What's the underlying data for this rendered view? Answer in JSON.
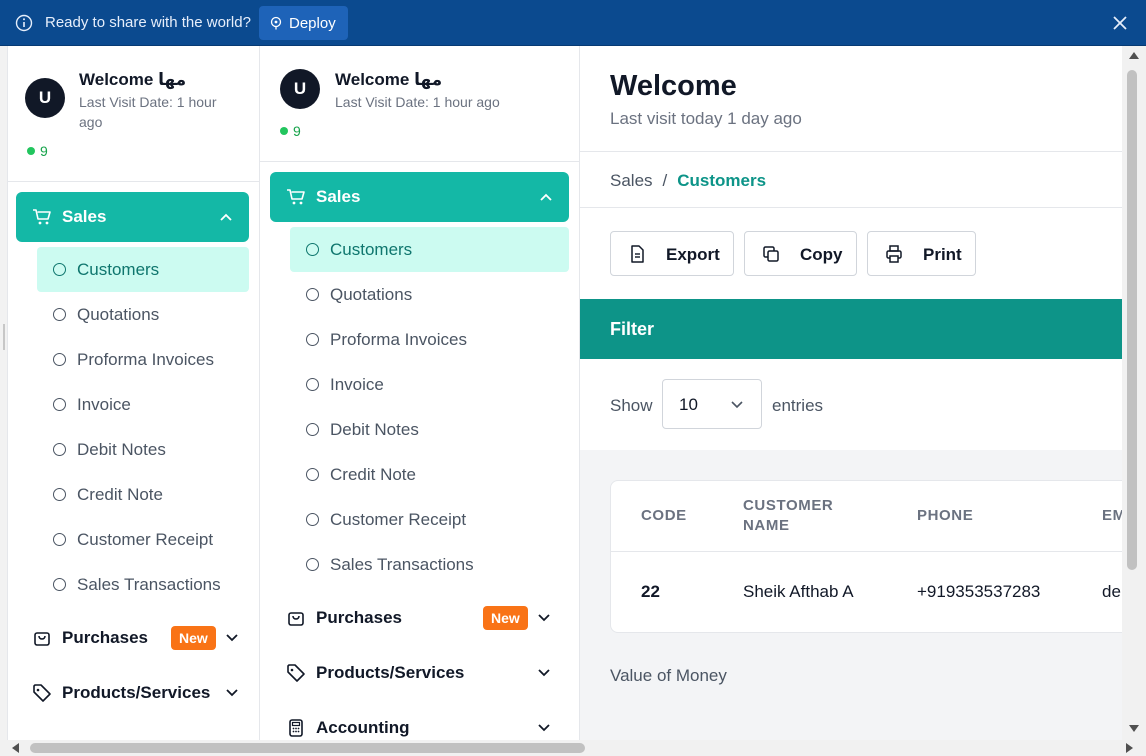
{
  "banner": {
    "text": "Ready to share with the world?",
    "deploy_label": "Deploy",
    "bg_color": "#0b4a8f"
  },
  "user": {
    "avatar_initial": "U",
    "welcome": "Welcome مها",
    "last_visit": "Last Visit Date: 1 hour ago",
    "online_count": "9"
  },
  "nav": {
    "sales_label": "Sales",
    "sales_items": [
      {
        "label": "Customers",
        "active": true
      },
      {
        "label": "Quotations"
      },
      {
        "label": "Proforma Invoices"
      },
      {
        "label": "Invoice"
      },
      {
        "label": "Debit Notes"
      },
      {
        "label": "Credit Note"
      },
      {
        "label": "Customer Receipt"
      },
      {
        "label": "Sales Transactions"
      }
    ],
    "purchases_label": "Purchases",
    "new_badge": "New",
    "products_label": "Products/Services",
    "accounting_label": "Accounting",
    "accent_color": "#14b8a6"
  },
  "main": {
    "title": "Welcome",
    "subtitle": "Last visit today 1 day ago",
    "breadcrumb": {
      "parent": "Sales",
      "separator": "/",
      "current": "Customers"
    },
    "toolbar": {
      "export": "Export",
      "copy": "Copy",
      "print": "Print"
    },
    "filter_label": "Filter",
    "show_label": "Show",
    "entries_value": "10",
    "entries_label": "entries",
    "table": {
      "headers": [
        "CODE",
        "CUSTOMER NAME",
        "PHONE",
        "EM"
      ],
      "rows": [
        {
          "code": "22",
          "name": "Sheik Afthab A",
          "phone": "+919353537283",
          "email": "de"
        }
      ]
    },
    "value_money": "Value of Money"
  }
}
